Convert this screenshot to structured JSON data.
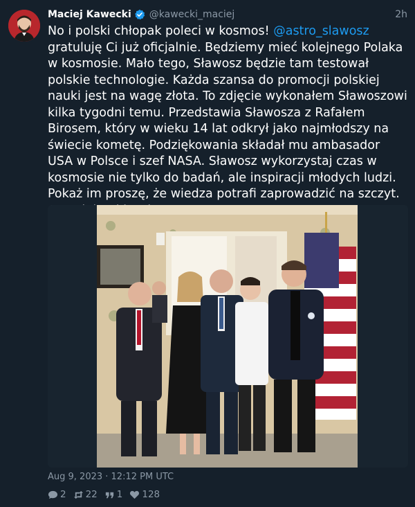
{
  "tweet": {
    "author_name": "Maciej Kawecki",
    "handle": "@kawecki_maciej",
    "time_ago": "2h",
    "text_intro": "No i polski chłopak poleci w kosmos! ",
    "mention": "@astro_slawosz",
    "text_body": " gratuluję Ci już oficjalnie. Będziemy mieć kolejnego Polaka w kosmosie. Mało tego, Sławosz będzie tam testował polskie technologie. Każda szansa do promocji polskiej nauki jest na wagę złota. To zdjęcie wykonałem Sławoszowi kilka tygodni temu. Przedstawia Sławosza z Rafałem Birosem, który w wieku 14 lat odkrył jako najmłodszy na świecie kometę. Podziękowania składał mu ambasador USA w Polsce i szef NASA. Sławosz wykorzystaj czas w kosmosie nie tylko do badań, ale inspiracji młodych ludzi. Pokaż im proszę, że wiedza potrafi zaprowadzić na szczyt. Gratuluję Ci bardzo!",
    "date": "Aug 9, 2023 · 12:12 PM UTC"
  },
  "stats": {
    "replies": "2",
    "retweets": "22",
    "quotes": "1",
    "likes": "128"
  },
  "colors": {
    "background": "#15202b",
    "link": "#1d9bf0",
    "muted": "#8b98a5",
    "verified": "#1d9bf0"
  },
  "icons": [
    "verified-badge-icon",
    "reply-icon",
    "retweet-icon",
    "quote-icon",
    "like-icon"
  ]
}
